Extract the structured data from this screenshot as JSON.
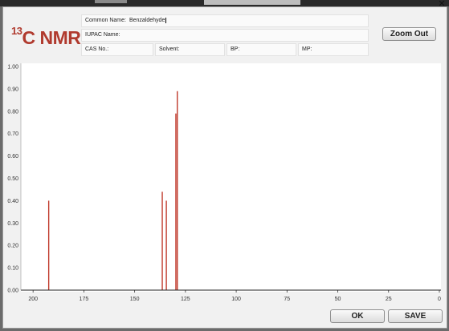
{
  "window": {
    "close_glyph": "✕"
  },
  "header": {
    "title_sup": "13",
    "title_main": "C NMR"
  },
  "fields": {
    "common_name_label": "Common Name:",
    "common_name_value": "Benzaldehyde",
    "iupac_label": "IUPAC Name:",
    "iupac_value": "",
    "cas_label": "CAS No.:",
    "solvent_label": "Solvent:",
    "bp_label": "BP:",
    "mp_label": "MP:"
  },
  "buttons": {
    "zoom_out": "Zoom Out",
    "ok": "OK",
    "save": "SAVE"
  },
  "colors": {
    "title": "#b03a2e",
    "peak": "#c0392b"
  },
  "chart_data": {
    "type": "bar",
    "xlim": [
      206,
      0
    ],
    "ylim": [
      0,
      1.0
    ],
    "x_ticks": [
      "200",
      "175",
      "150",
      "125",
      "100",
      "75",
      "50",
      "25",
      "0"
    ],
    "y_ticks": [
      "0.00",
      "0.10",
      "0.20",
      "0.30",
      "0.40",
      "0.50",
      "0.60",
      "0.70",
      "0.80",
      "0.90",
      "1.00"
    ],
    "series": [
      {
        "x": [
          192.3,
          136.4,
          134.4,
          129.7,
          129.0
        ],
        "y": [
          0.4,
          0.44,
          0.4,
          0.79,
          0.89
        ]
      }
    ],
    "grid": false
  }
}
